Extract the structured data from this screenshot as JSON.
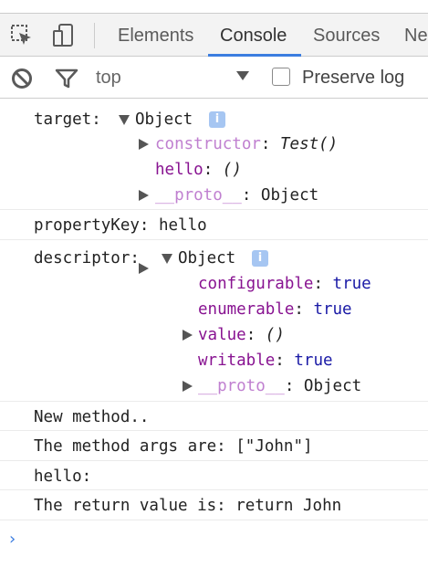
{
  "toolbar": {
    "tabs": [
      "Elements",
      "Console",
      "Sources",
      "Ne"
    ],
    "active_tab": "Console"
  },
  "filterbar": {
    "context": "top",
    "preserve_log_label": "Preserve log"
  },
  "console": {
    "msg1": {
      "label": "target:",
      "object": "Object",
      "info": "i",
      "props": [
        {
          "key": "constructor",
          "sep": ":",
          "value": "Test()"
        },
        {
          "key": "hello",
          "sep": ":",
          "value": "()"
        },
        {
          "key": "__proto__",
          "sep": ":",
          "value": "Object"
        }
      ]
    },
    "msg2": {
      "text": "propertyKey: hello"
    },
    "msg3": {
      "label": "descriptor:",
      "object": "Object",
      "info": "i",
      "props": [
        {
          "key": "configurable",
          "sep": ":",
          "value": "true"
        },
        {
          "key": "enumerable",
          "sep": ":",
          "value": "true"
        },
        {
          "key": "value",
          "sep": ":",
          "value": "()"
        },
        {
          "key": "writable",
          "sep": ":",
          "value": "true"
        },
        {
          "key": "__proto__",
          "sep": ":",
          "value": "Object"
        }
      ]
    },
    "msg4": {
      "text": "New method.."
    },
    "msg5": {
      "text": "The method args are: [\"John\"]"
    },
    "msg6": {
      "text": "hello:"
    },
    "msg7": {
      "text": "The return value is: return John"
    },
    "prompt": "›"
  },
  "colors": {
    "accent": "#3b7de0",
    "property_key": "#881391",
    "inherited_key": "#c080d0"
  }
}
